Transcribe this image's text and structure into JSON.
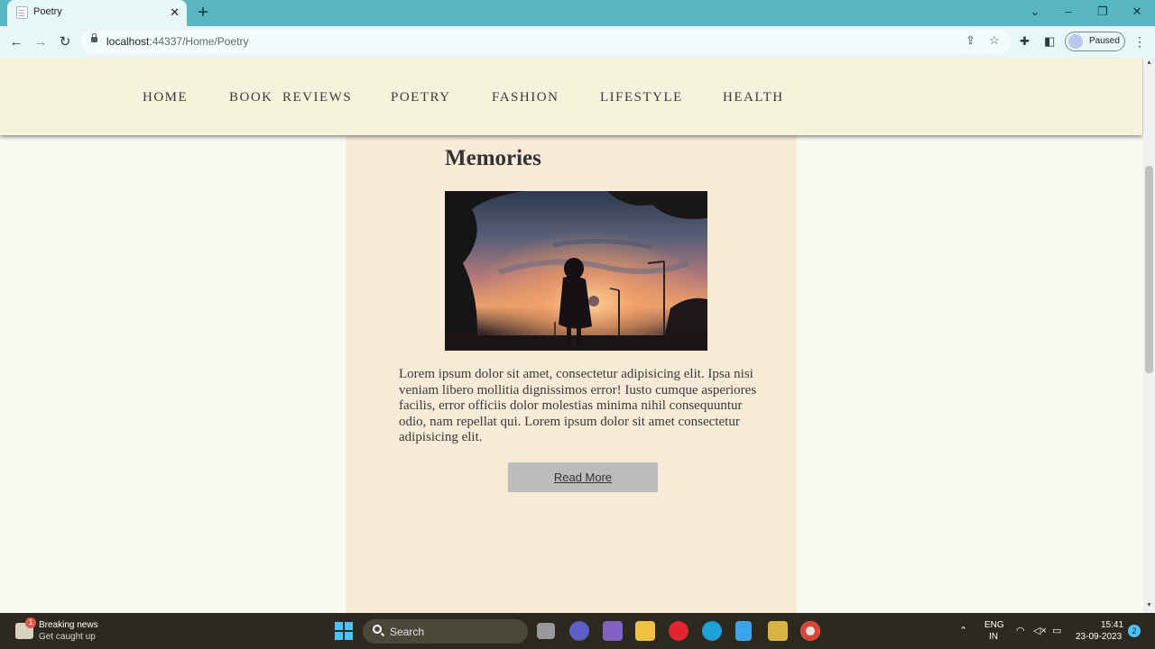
{
  "browser": {
    "tab_title": "Poetry",
    "url_host": "localhost",
    "url_rest": ":44337/Home/Poetry",
    "profile_label": "Paused"
  },
  "site": {
    "nav": [
      "HOME",
      "BOOK  REVIEWS",
      "POETRY",
      "FASHION",
      "LIFESTYLE",
      "HEALTH"
    ]
  },
  "post": {
    "title": "Memories",
    "image_alt": "silhouette of a girl holding flowers at sunset",
    "body": "Lorem ipsum dolor sit amet, consectetur adipisicing elit. Ipsa nisi veniam libero mollitia dignissimos error! Iusto cumque asperiores facilis, error officiis dolor molestias minima nihil consequuntur odio, nam repellat qui. Lorem ipsum dolor sit amet consectetur adipisicing elit.",
    "read_more": "Read More"
  },
  "taskbar": {
    "news_badge": "1",
    "news_title": "Breaking news",
    "news_sub": "Get caught up",
    "search_label": "Search",
    "lang_top": "ENG",
    "lang_bottom": "IN",
    "time": "15:41",
    "date": "23-09-2023",
    "notifications": "2"
  },
  "colors": {
    "titlebar": "#59b7c4",
    "nav_bg": "#f5f3dc",
    "content_bg": "#f7ebd8",
    "page_bg": "#fbfaf2",
    "button_bg": "#bcbcbc"
  }
}
